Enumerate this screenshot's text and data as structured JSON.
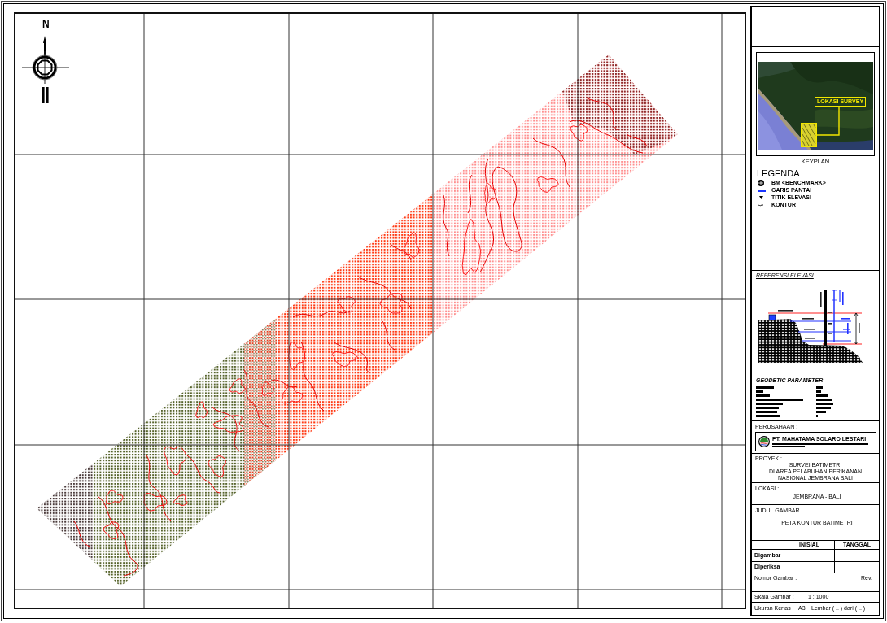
{
  "north_arrow": {
    "label": "N"
  },
  "keyplan": {
    "annotation": "LOKASI SURVEY",
    "caption": "KEYPLAN"
  },
  "legend": {
    "title": "LEGENDA",
    "items": [
      {
        "kind": "benchmark",
        "label": "BM <BENCHMARK>"
      },
      {
        "kind": "coastline",
        "label": "GARIS PANTAI"
      },
      {
        "kind": "elevation_point",
        "label": "TITIK ELEVASI"
      },
      {
        "kind": "contour",
        "label": "KONTUR"
      }
    ]
  },
  "elevation_reference": {
    "title": "REFERENSI ELEVASI"
  },
  "geodetic_parameter": {
    "title": "GEODETIC PARAMETER"
  },
  "company": {
    "label": "PERUSAHAAN :",
    "name": "PT. MAHATAMA SOLARO LESTARI"
  },
  "project": {
    "label": "PROYEK :",
    "lines": [
      "SURVEI BATIMETRI",
      "DI AREA PELABUHAN PERIKANAN NASIONAL JEMBRANA BALI"
    ]
  },
  "location": {
    "label": "LOKASI :",
    "value": "JEMBRANA - BALI"
  },
  "drawing_title": {
    "label": "JUDUL GAMBAR :",
    "value": "PETA KONTUR BATIMETRI"
  },
  "approval": {
    "columns": [
      "INISIAL",
      "TANGGAL"
    ],
    "rows": [
      "Digambar",
      "Diperiksa"
    ]
  },
  "drawing_number": {
    "label": "Nomor Gambar :",
    "rev_label": "Rev."
  },
  "scale": {
    "label": "Skala Gambar :",
    "value": "1 : 1000"
  },
  "paper": {
    "label": "Ukuran Kertas",
    "value": "A3",
    "sheet": "Lembar ( .. ) dari ( .. )"
  }
}
